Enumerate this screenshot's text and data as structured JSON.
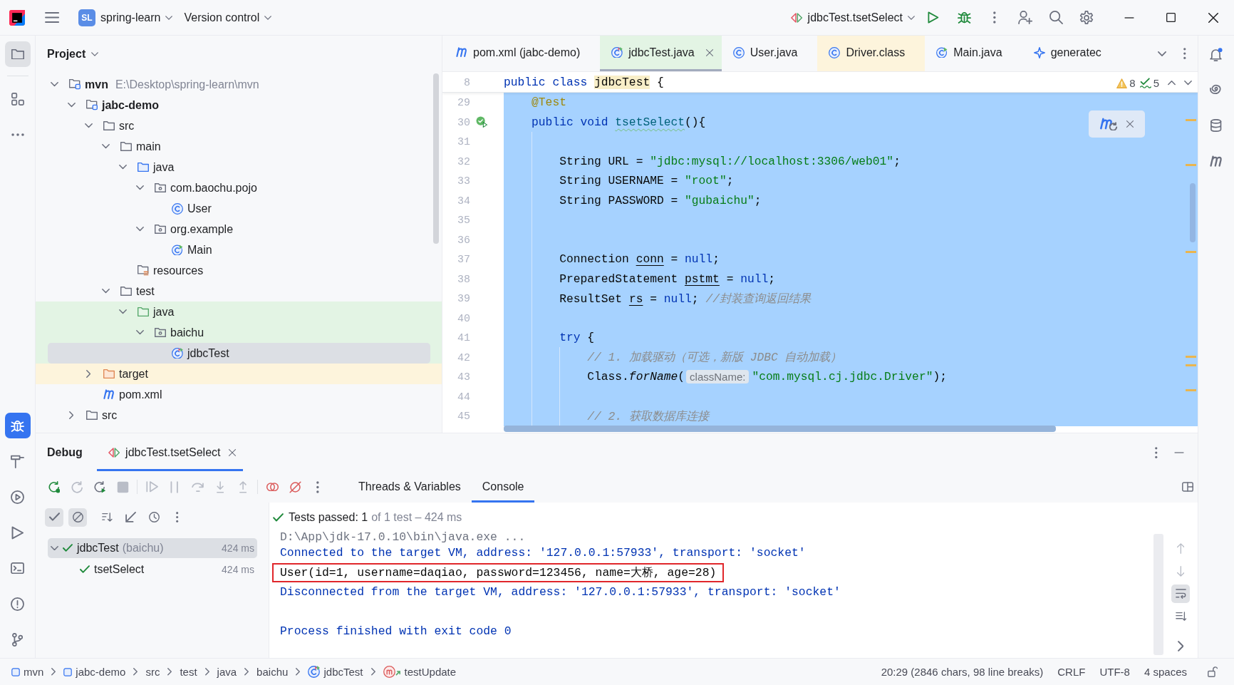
{
  "title_bar": {
    "project_badge": "SL",
    "project_name": "spring-learn",
    "vcs_menu": "Version control",
    "run_config": "jdbcTest.tsetSelect"
  },
  "left_toolbar": {
    "top": [
      {
        "kind": "project",
        "selected": true
      },
      {
        "kind": "structure",
        "selected": false
      },
      {
        "kind": "more",
        "selected": false
      }
    ],
    "bottom": [
      {
        "kind": "debug",
        "selected": true
      },
      {
        "kind": "build",
        "selected": false
      },
      {
        "kind": "services",
        "selected": false
      },
      {
        "kind": "run",
        "selected": false
      },
      {
        "kind": "terminal",
        "selected": false
      },
      {
        "kind": "problems",
        "selected": false
      },
      {
        "kind": "git",
        "selected": false
      }
    ]
  },
  "project_panel": {
    "title": "Project",
    "tree": [
      {
        "label": "mvn",
        "path": "E:\\Desktop\\spring-learn\\mvn",
        "kind": "module",
        "expanded": true,
        "selected": false,
        "children": [
          {
            "label": "jabc-demo",
            "kind": "module",
            "expanded": true,
            "selected": false,
            "children": [
              {
                "label": "src",
                "kind": "folder",
                "expanded": true,
                "selected": false,
                "children": [
                  {
                    "label": "main",
                    "kind": "folder",
                    "expanded": true,
                    "selected": false,
                    "children": [
                      {
                        "label": "java",
                        "kind": "source",
                        "expanded": true,
                        "selected": false,
                        "children": [
                          {
                            "label": "com.baochu.pojo",
                            "kind": "package",
                            "expanded": true,
                            "selected": false,
                            "children": [
                              {
                                "label": "User",
                                "kind": "class",
                                "selected": false
                              }
                            ]
                          },
                          {
                            "label": "org.example",
                            "kind": "package",
                            "expanded": true,
                            "selected": false,
                            "children": [
                              {
                                "label": "Main",
                                "kind": "main-class",
                                "selected": false
                              }
                            ]
                          }
                        ]
                      },
                      {
                        "label": "resources",
                        "kind": "resources",
                        "selected": false
                      }
                    ]
                  },
                  {
                    "label": "test",
                    "kind": "folder",
                    "expanded": true,
                    "selected": false,
                    "children": [
                      {
                        "label": "java",
                        "kind": "test-source",
                        "test_scope": true,
                        "expanded": true,
                        "selected": false,
                        "children": [
                          {
                            "label": "baichu",
                            "kind": "package",
                            "test_scope": true,
                            "expanded": true,
                            "selected": false,
                            "children": [
                              {
                                "label": "jdbcTest",
                                "kind": "test-class",
                                "test_scope": true,
                                "selected": true
                              }
                            ]
                          }
                        ]
                      }
                    ]
                  }
                ]
              },
              {
                "label": "target",
                "kind": "excluded",
                "excluded": true,
                "expanded": false,
                "selected": false
              },
              {
                "label": "pom.xml",
                "kind": "maven",
                "selected": false
              }
            ]
          },
          {
            "label": "src",
            "kind": "folder",
            "expanded": false,
            "selected": false
          }
        ]
      }
    ]
  },
  "editor": {
    "tabs": [
      {
        "label": "pom.xml (jabc-demo)",
        "kind": "maven",
        "selected": false
      },
      {
        "label": "jdbcTest.java",
        "kind": "test-class",
        "test_scope": true,
        "selected": true
      },
      {
        "label": "User.java",
        "kind": "class",
        "selected": false
      },
      {
        "label": "Driver.class",
        "kind": "class",
        "library": true,
        "selected": false
      },
      {
        "label": "Main.java",
        "kind": "main-class",
        "selected": false
      },
      {
        "label": "generatec",
        "kind": "generated",
        "selected": false
      }
    ],
    "sticky_line": {
      "n": "8",
      "code": [
        {
          "text": "public class ",
          "kind": "keyword"
        },
        {
          "text": "jdbcTest",
          "kind": "usage"
        },
        {
          "text": " {",
          "kind": "plain"
        }
      ]
    },
    "inspections": {
      "warnings": "8",
      "passed": "5"
    },
    "maven_reload_prompt": true,
    "selection": true,
    "lines": [
      {
        "n": "29",
        "code": [
          {
            "text": "    @Test",
            "kind": "annotation"
          }
        ]
      },
      {
        "n": "30",
        "run_marker": true,
        "code": [
          {
            "text": "    public void ",
            "kind": "keyword"
          },
          {
            "text": "tsetSelect",
            "kind": "method"
          },
          {
            "text": "(){",
            "kind": "plain"
          }
        ]
      },
      {
        "n": "31"
      },
      {
        "n": "32",
        "code": [
          {
            "text": "        String URL = ",
            "kind": "plain"
          },
          {
            "text": "\"jdbc:mysql://localhost:3306/web01\"",
            "kind": "string"
          },
          {
            "text": ";",
            "kind": "plain"
          }
        ]
      },
      {
        "n": "33",
        "code": [
          {
            "text": "        String USERNAME = ",
            "kind": "plain"
          },
          {
            "text": "\"root\"",
            "kind": "string"
          },
          {
            "text": ";",
            "kind": "plain"
          }
        ]
      },
      {
        "n": "34",
        "code": [
          {
            "text": "        String PASSWORD = ",
            "kind": "plain"
          },
          {
            "text": "\"gubaichu\"",
            "kind": "string"
          },
          {
            "text": ";",
            "kind": "plain"
          }
        ]
      },
      {
        "n": "35"
      },
      {
        "n": "36"
      },
      {
        "n": "37",
        "code": [
          {
            "text": "        Connection ",
            "kind": "plain"
          },
          {
            "text": "conn",
            "kind": "var"
          },
          {
            "text": " = ",
            "kind": "plain"
          },
          {
            "text": "null",
            "kind": "keyword"
          },
          {
            "text": ";",
            "kind": "plain"
          }
        ]
      },
      {
        "n": "38",
        "code": [
          {
            "text": "        PreparedStatement ",
            "kind": "plain"
          },
          {
            "text": "pstmt",
            "kind": "var"
          },
          {
            "text": " = ",
            "kind": "plain"
          },
          {
            "text": "null",
            "kind": "keyword"
          },
          {
            "text": ";",
            "kind": "plain"
          }
        ]
      },
      {
        "n": "39",
        "code": [
          {
            "text": "        ResultSet ",
            "kind": "plain"
          },
          {
            "text": "rs",
            "kind": "var"
          },
          {
            "text": " = ",
            "kind": "plain"
          },
          {
            "text": "null",
            "kind": "keyword"
          },
          {
            "text": "; ",
            "kind": "plain"
          },
          {
            "text": "//封装查询返回结果",
            "kind": "comment"
          }
        ]
      },
      {
        "n": "40"
      },
      {
        "n": "41",
        "code": [
          {
            "text": "        try",
            "kind": "keyword"
          },
          {
            "text": " {",
            "kind": "plain"
          }
        ]
      },
      {
        "n": "42",
        "code": [
          {
            "text": "            // 1. 加载驱动（可选，新版 JDBC 自动加载）",
            "kind": "comment"
          }
        ]
      },
      {
        "n": "43",
        "code": [
          {
            "text": "            Class.",
            "kind": "plain"
          },
          {
            "text": "forName",
            "kind": "static"
          },
          {
            "text": "(",
            "kind": "plain"
          },
          {
            "text": "className:",
            "kind": "hint"
          },
          {
            "text": "\"com.mysql.cj.jdbc.Driver\"",
            "kind": "string"
          },
          {
            "text": ");",
            "kind": "plain"
          }
        ]
      },
      {
        "n": "44"
      },
      {
        "n": "45",
        "code": [
          {
            "text": "            // 2. 获取数据库连接",
            "kind": "comment"
          }
        ]
      }
    ]
  },
  "right_toolbar": [
    {
      "kind": "notifications",
      "unread": true
    },
    {
      "kind": "ai-assistant"
    },
    {
      "kind": "database"
    },
    {
      "kind": "maven"
    }
  ],
  "debug_panel": {
    "title": "Debug",
    "session_tab": {
      "label": "jdbcTest.tsetSelect",
      "selected": true
    },
    "toolbar": [
      [
        {
          "kind": "rerun-debug",
          "disabled": false
        },
        {
          "kind": "rerun",
          "disabled": true
        },
        {
          "kind": "rerun-failed",
          "disabled": false
        },
        {
          "kind": "stop",
          "disabled": true
        }
      ],
      [
        {
          "kind": "resume",
          "disabled": true
        },
        {
          "kind": "pause",
          "disabled": true
        },
        {
          "kind": "step-over",
          "disabled": true
        },
        {
          "kind": "step-into",
          "disabled": true
        },
        {
          "kind": "step-out",
          "disabled": true
        }
      ],
      [
        {
          "kind": "breakpoints",
          "disabled": false
        },
        {
          "kind": "mute-breakpoints",
          "disabled": false
        },
        {
          "kind": "more",
          "disabled": false
        }
      ]
    ],
    "view_tabs": [
      {
        "label": "Threads & Variables",
        "selected": false
      },
      {
        "label": "Console",
        "selected": true
      }
    ],
    "test_filters": [
      {
        "kind": "show-passed",
        "selected": true
      },
      {
        "kind": "show-ignored",
        "selected": true
      },
      {
        "kind": "sort",
        "selected": false
      },
      {
        "kind": "collapse",
        "selected": false
      },
      {
        "kind": "history",
        "selected": false
      },
      {
        "kind": "more",
        "selected": false
      }
    ],
    "test_status": {
      "passed": true,
      "summary": "Tests passed: 1",
      "detail": "of 1 test – 424 ms"
    },
    "test_tree": [
      {
        "label": "jdbcTest",
        "package": "(baichu)",
        "time": "424 ms",
        "passed": true,
        "expanded": true,
        "selected": true,
        "children": [
          {
            "label": "tsetSelect",
            "time": "424 ms",
            "passed": true,
            "selected": false
          }
        ]
      }
    ],
    "console": [
      {
        "kind": "command",
        "text": "D:\\App\\jdk-17.0.10\\bin\\java.exe ..."
      },
      {
        "kind": "system",
        "text": "Connected to the target VM, address: '127.0.0.1:57933', transport: 'socket'"
      },
      {
        "kind": "output",
        "text": "User(id=1, username=daqiao, password=123456, name=大桥, age=28)",
        "outlined": true
      },
      {
        "kind": "system",
        "text": "Disconnected from the target VM, address: '127.0.0.1:57933', transport: 'socket'"
      },
      {
        "kind": "blank"
      },
      {
        "kind": "system",
        "text": "Process finished with exit code 0"
      }
    ],
    "console_tools": [
      {
        "kind": "previous",
        "disabled": true,
        "selected": false
      },
      {
        "kind": "next",
        "disabled": true,
        "selected": false
      },
      {
        "kind": "soft-wrap",
        "disabled": false,
        "selected": true
      },
      {
        "kind": "scroll-to-end",
        "disabled": false,
        "selected": false
      },
      {
        "kind": "expand",
        "disabled": false,
        "selected": false
      }
    ]
  },
  "status_bar": {
    "breadcrumbs": [
      {
        "kind": "module",
        "label": "mvn"
      },
      {
        "kind": "module",
        "label": "jabc-demo"
      },
      {
        "kind": "plain",
        "label": "src"
      },
      {
        "kind": "plain",
        "label": "test"
      },
      {
        "kind": "plain",
        "label": "java"
      },
      {
        "kind": "plain",
        "label": "baichu"
      },
      {
        "kind": "test-class",
        "label": "jdbcTest"
      },
      {
        "kind": "method",
        "label": "testUpdate"
      }
    ],
    "caret_info": "20:29 (2846 chars, 98 line breaks)",
    "line_separator": "CRLF",
    "encoding": "UTF-8",
    "indent": "4 spaces",
    "read_only": false
  }
}
